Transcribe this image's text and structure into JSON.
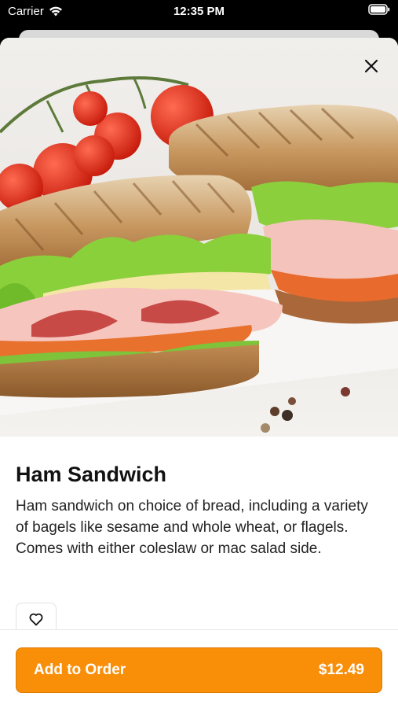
{
  "status_bar": {
    "carrier": "Carrier",
    "time": "12:35 PM"
  },
  "item": {
    "title": "Ham Sandwich",
    "description": "Ham sandwich on choice of bread, including a variety of bagels like sesame and whole wheat, or flagels. Comes with either coleslaw or mac salad side."
  },
  "footer": {
    "add_label": "Add to Order",
    "price": "$12.49"
  },
  "icons": {
    "close": "close-icon",
    "favorite": "heart-icon",
    "wifi": "wifi-icon",
    "battery": "battery-icon"
  },
  "colors": {
    "accent": "#f98f09"
  }
}
